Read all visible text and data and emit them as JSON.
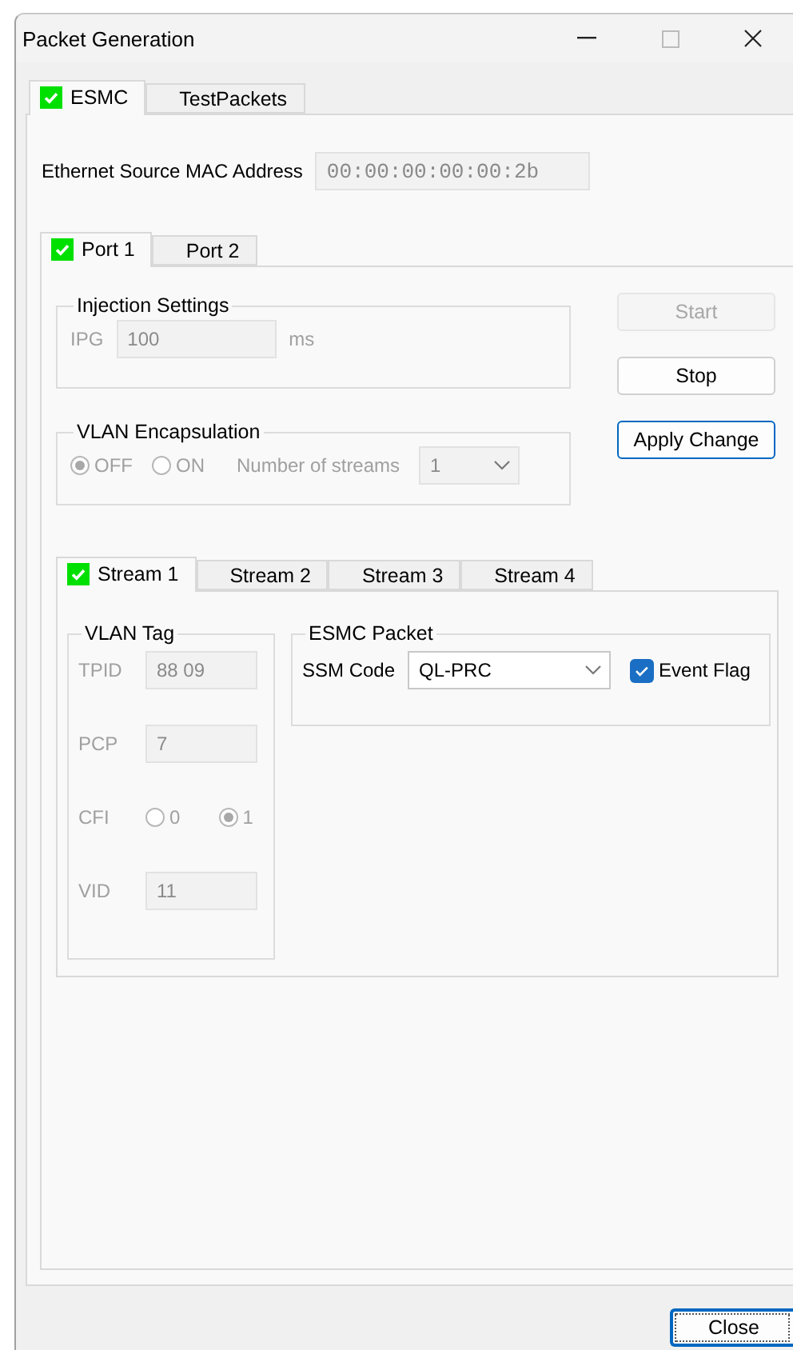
{
  "window": {
    "title": "Packet Generation"
  },
  "tabs": [
    {
      "label": "ESMC",
      "selected": true,
      "checked": true
    },
    {
      "label": "TestPackets",
      "selected": false,
      "checked": false
    }
  ],
  "mac": {
    "label": "Ethernet Source MAC Address",
    "value": "00:00:00:00:00:2b"
  },
  "port_tabs": [
    {
      "label": "Port 1",
      "selected": true,
      "checked": true
    },
    {
      "label": "Port 2",
      "selected": false,
      "checked": false
    }
  ],
  "injection": {
    "title": "Injection Settings",
    "label": "IPG",
    "value": "100",
    "unit": "ms",
    "disabled": true
  },
  "vlan_encapsulation": {
    "title": "VLAN Encapsulation",
    "disabled": true,
    "options": [
      {
        "label": "OFF",
        "selected": true
      },
      {
        "label": "ON",
        "selected": false
      }
    ],
    "streams_label": "Number of streams",
    "streams_value": "1"
  },
  "buttons": [
    {
      "label": "Start",
      "disabled": true,
      "focused": false
    },
    {
      "label": "Stop",
      "disabled": false,
      "focused": false
    },
    {
      "label": "Apply Change",
      "disabled": false,
      "focused": true
    }
  ],
  "stream_tabs": [
    {
      "label": "Stream 1",
      "selected": true,
      "checked": true
    },
    {
      "label": "Stream 2",
      "selected": false,
      "checked": false
    },
    {
      "label": "Stream 3",
      "selected": false,
      "checked": false
    },
    {
      "label": "Stream 4",
      "selected": false,
      "checked": false
    }
  ],
  "vlan_tag": {
    "title": "VLAN Tag",
    "disabled": true,
    "fields": [
      {
        "kind": "field",
        "label": "TPID",
        "value": "88 09"
      },
      {
        "kind": "field",
        "label": "PCP",
        "value": "7"
      },
      {
        "kind": "radio",
        "label": "CFI",
        "options": [
          {
            "label": "0",
            "selected": false
          },
          {
            "label": "1",
            "selected": true
          }
        ]
      },
      {
        "kind": "field",
        "label": "VID",
        "value": "11"
      }
    ]
  },
  "esmc_packet": {
    "title": "ESMC Packet",
    "ssm_label": "SSM Code",
    "ssm_value": "QL-PRC",
    "event_flag": {
      "label": "Event Flag",
      "checked": true
    }
  },
  "close_button": {
    "label": "Close",
    "focused": true
  }
}
